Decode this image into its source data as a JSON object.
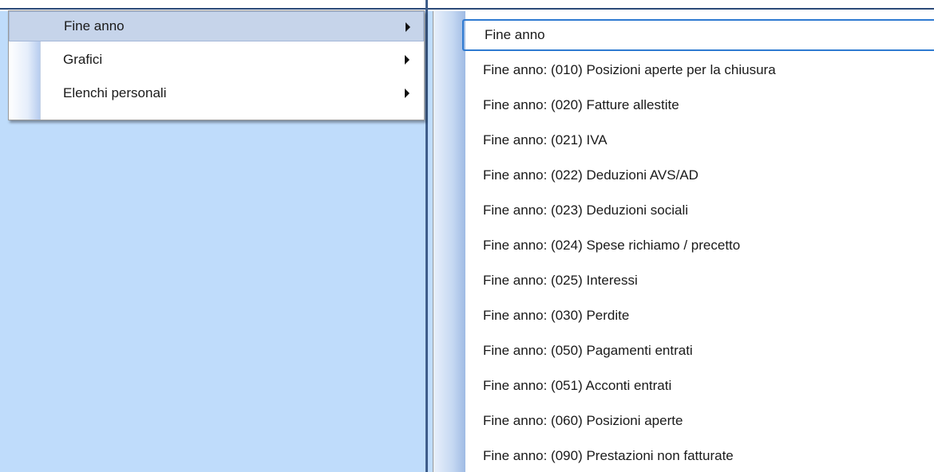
{
  "left_menu": {
    "items": [
      {
        "label": "Fine anno",
        "has_submenu": true,
        "highlighted": true
      },
      {
        "label": "Grafici",
        "has_submenu": true,
        "highlighted": false
      },
      {
        "label": "Elenchi personali",
        "has_submenu": true,
        "highlighted": false
      }
    ]
  },
  "right_menu": {
    "items": [
      {
        "label": "Fine anno",
        "focused": true
      },
      {
        "label": "Fine anno: (010) Posizioni aperte per la chiusura"
      },
      {
        "label": "Fine anno: (020) Fatture allestite"
      },
      {
        "label": "Fine anno: (021) IVA"
      },
      {
        "label": "Fine anno: (022) Deduzioni AVS/AD"
      },
      {
        "label": "Fine anno: (023) Deduzioni sociali"
      },
      {
        "label": "Fine anno: (024) Spese richiamo / precetto"
      },
      {
        "label": "Fine anno: (025) Interessi"
      },
      {
        "label": "Fine anno: (030) Perdite"
      },
      {
        "label": "Fine anno: (050) Pagamenti entrati"
      },
      {
        "label": "Fine anno: (051) Acconti entrati"
      },
      {
        "label": "Fine anno: (060) Posizioni aperte"
      },
      {
        "label": "Fine anno: (090) Prestazioni non fatturate"
      }
    ]
  },
  "icons": {
    "submenu_arrow": "triangle-right-icon"
  },
  "colors": {
    "background": "#bfdcfb",
    "highlight": "#c6d4ea",
    "focus_border": "#2e7ad1"
  }
}
